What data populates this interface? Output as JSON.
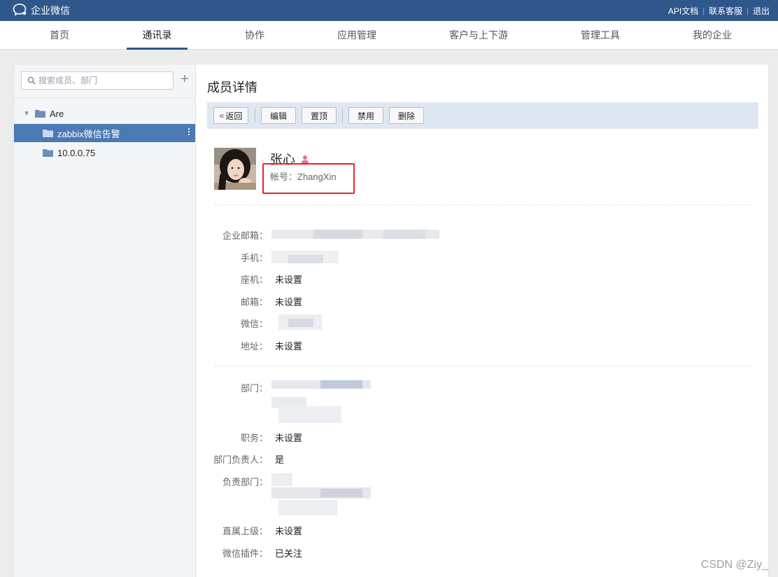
{
  "header": {
    "app_name": "企业微信",
    "links": [
      "API文档",
      "联系客服",
      "退出"
    ]
  },
  "nav": {
    "items": [
      "首页",
      "通讯录",
      "协作",
      "应用管理",
      "客户与上下游",
      "管理工具",
      "我的企业"
    ],
    "active": "通讯录"
  },
  "sidebar": {
    "search_placeholder": "搜索成员、部门",
    "tree": [
      {
        "label": "Are",
        "expanded": true
      },
      {
        "label": "zabbix微信告警",
        "selected": true
      },
      {
        "label": "10.0.0.75"
      }
    ]
  },
  "detail": {
    "title": "成员详情",
    "toolbar": {
      "back": "返回",
      "edit": "编辑",
      "pin": "置顶",
      "disable": "禁用",
      "delete": "删除"
    },
    "name": "张心",
    "account": "帐号：ZhangXin",
    "fields": {
      "corp_email_label": "企业邮箱：",
      "mobile_label": "手机：",
      "phone_label": "座机：",
      "phone_value": "未设置",
      "email_label": "邮箱：",
      "email_value": "未设置",
      "wechat_label": "微信：",
      "address_label": "地址：",
      "address_value": "未设置",
      "dept_label": "部门：",
      "position_label": "职务：",
      "position_value": "未设置",
      "is_leader_label": "部门负责人：",
      "is_leader_value": "是",
      "lead_dept_label": "负责部门：",
      "superior_label": "直属上级：",
      "superior_value": "未设置",
      "plugin_label": "微信插件：",
      "plugin_value": "已关注"
    }
  },
  "watermark": "CSDN @Ziy_",
  "colors": {
    "topbar": "#30578b",
    "selected": "#4a79b3",
    "toolbar_bg": "#dfe7f2",
    "highlight_border": "#e8242b"
  }
}
